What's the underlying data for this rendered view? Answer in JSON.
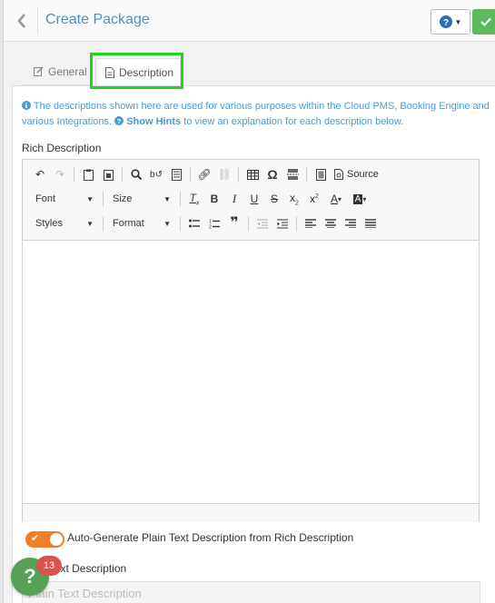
{
  "header": {
    "title": "Create Package",
    "help_icon": "question-circle-icon",
    "save_icon": "check-icon"
  },
  "tabs": [
    {
      "label": "General",
      "icon": "edit-icon"
    },
    {
      "label": "Description",
      "icon": "file-icon",
      "active": true
    }
  ],
  "info": {
    "text_before": "The descriptions shown here are used for various purposes within the Cloud PMS, Booking Engine and various Integrations.",
    "hints_label": "Show Hints",
    "text_after": "to view an explanation for each description below."
  },
  "rich_description": {
    "label": "Rich Description",
    "source_label": "Source",
    "font_combo": "Font",
    "size_combo": "Size",
    "styles_combo": "Styles",
    "format_combo": "Format"
  },
  "auto_generate": {
    "label": "Auto-Generate Plain Text Description from Rich Description",
    "enabled": true
  },
  "plain_text": {
    "label": "Plain Text Description",
    "placeholder": "Plain Text  Description"
  },
  "help_fab": {
    "icon": "question-icon",
    "badge": "13"
  },
  "colors": {
    "accent": "#4a90c4",
    "success": "#5cb85c",
    "toggle": "#f07d2a",
    "highlight": "#22d322",
    "badge": "#d9534f"
  }
}
